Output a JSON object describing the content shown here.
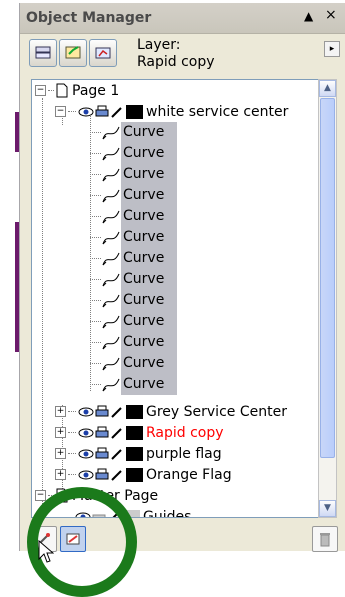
{
  "window": {
    "title": "Object Manager",
    "btn_min": "▲",
    "btn_close": "×"
  },
  "layer": {
    "line1": "Layer:",
    "line2": "Rapid copy"
  },
  "tree": {
    "page1": "Page 1",
    "white_center": "white service center",
    "curve": "Curve",
    "grey_center": "Grey Service Center",
    "rapid_copy": "Rapid copy",
    "purple_flag": "purple flag",
    "orange_flag": "Orange Flag",
    "master_page": "Master Page",
    "guides": "Guides"
  },
  "colors": {
    "highlight": "#bdbec6",
    "red_text": "#ff0000",
    "circle": "#1b7a1b"
  }
}
